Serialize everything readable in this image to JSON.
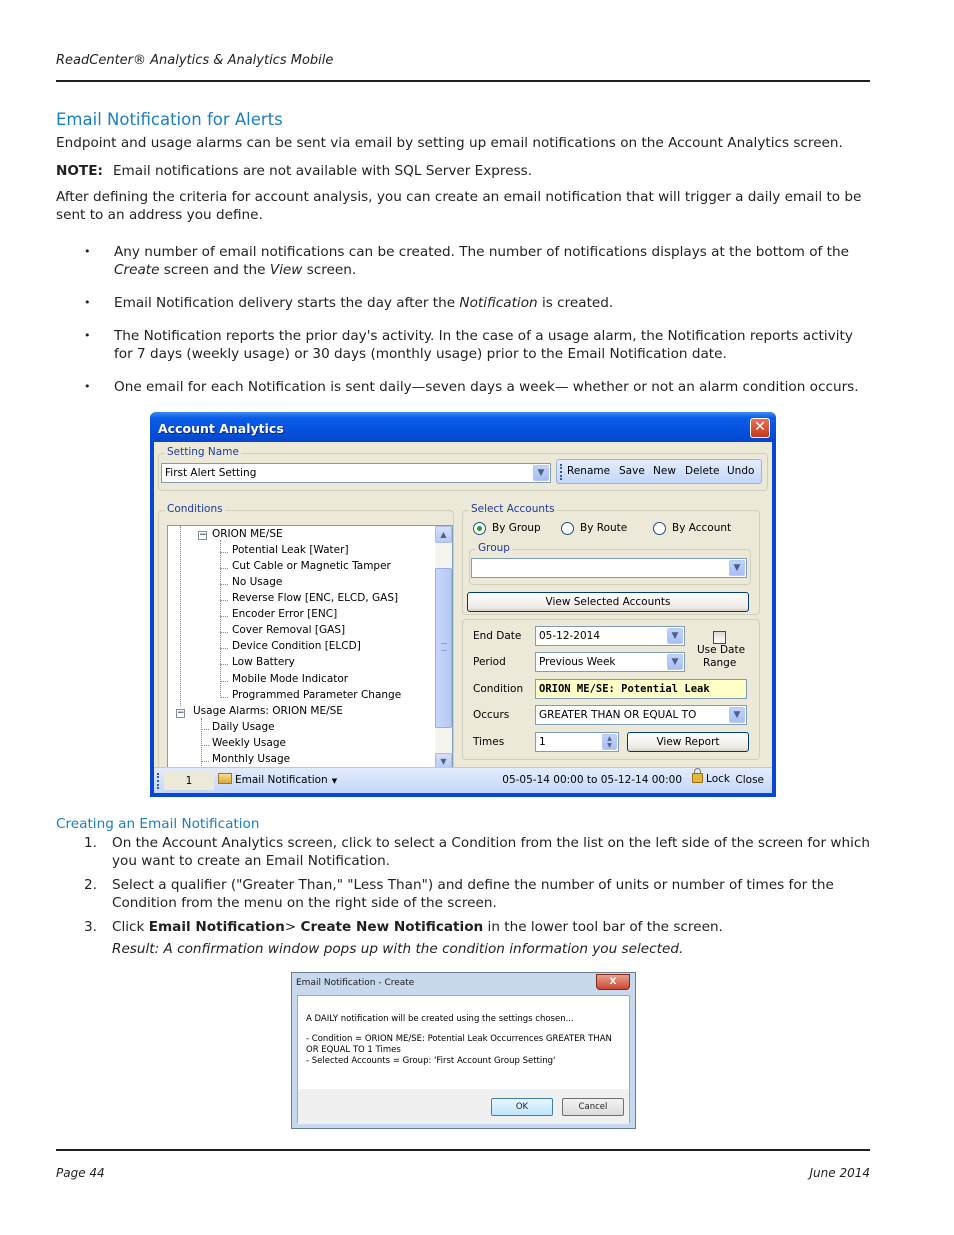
{
  "header": {
    "title": "ReadCenter® Analytics & Analytics Mobile"
  },
  "section": {
    "heading": "Email Notification for Alerts",
    "intro": "Endpoint and usage alarms can be sent via email by setting up email notifications on the Account Analytics screen.",
    "note_label": "NOTE:",
    "note_text": "Email notifications are not available with SQL Server Express.",
    "paragraph": "After defining the criteria for account analysis, you can create an email notification that will trigger a daily email to be sent to an address you define.",
    "bullets": [
      {
        "pre": "Any number of email notifications can be created. The number of notifications displays at the bottom of the ",
        "em1": "Create",
        "mid": " screen and the ",
        "em2": "View",
        "post": " screen."
      },
      {
        "pre": "Email Notification delivery starts the day after the ",
        "em1": "Notification",
        "post": " is created."
      },
      {
        "text": "The Notification reports the prior day's activity. In the case of a usage alarm, the Notification reports activity for 7 days (weekly usage) or 30 days (monthly usage) prior to the Email Notification date."
      },
      {
        "text": "One email for each Notification is sent daily—seven days a week— whether or not an alarm condition occurs."
      }
    ],
    "bullet_glyph": "•"
  },
  "window": {
    "title": "Account Analytics",
    "close_glyph": "✕",
    "setting_name": {
      "label": "Setting Name",
      "value": "First Alert Setting"
    },
    "toolbar": {
      "rename": "Rename",
      "save": "Save",
      "new": "New",
      "delete": "Delete",
      "undo": "Undo"
    },
    "conditions": {
      "label": "Conditions",
      "tree": {
        "group1": "ORION ME/SE",
        "group1_items": [
          "Potential Leak [Water]",
          "Cut Cable or Magnetic Tamper",
          "No Usage",
          "Reverse Flow [ENC, ELCD, GAS]",
          "Encoder Error [ENC]",
          "Cover Removal [GAS]",
          "Device Condition [ELCD]",
          "Low Battery",
          "Mobile Mode Indicator",
          "Programmed Parameter Change"
        ],
        "group2": "Usage Alarms: ORION ME/SE",
        "group2_items": [
          "Daily Usage",
          "Weekly Usage",
          "Monthly Usage"
        ],
        "expander_glyph": "−"
      }
    },
    "select_accounts": {
      "label": "Select Accounts",
      "options": [
        "By Group",
        "By Route",
        "By Account"
      ],
      "selected": "By Group",
      "group_label": "Group",
      "group_value": "",
      "view_button": "View Selected Accounts"
    },
    "criteria": {
      "end_date_label": "End Date",
      "end_date_value": "05-12-2014",
      "period_label": "Period",
      "period_value": "Previous Week",
      "use_date_range_label_1": "Use Date",
      "use_date_range_label_2": "Range",
      "use_date_range_checked": false,
      "condition_label": "Condition",
      "condition_value": "ORION ME/SE: Potential Leak",
      "occurs_label": "Occurs",
      "occurs_value": "GREATER THAN OR EQUAL TO",
      "times_label": "Times",
      "times_value": "1",
      "view_report_button": "View Report"
    },
    "statusbar": {
      "count": "1",
      "email_notification": "Email Notification",
      "range": "05-05-14 00:00 to 05-12-14 00:00",
      "lock": "Lock",
      "close": "Close"
    },
    "colors": {
      "title_bar": "#0552dc",
      "client_bg": "#ece9d8",
      "condition_bg": "#ffffc8"
    }
  },
  "creating": {
    "heading": "Creating an Email Notification",
    "steps": [
      {
        "num": "1.",
        "text": "On the Account Analytics screen, click to select a Condition from the list on the left side of the screen for which you want to create an Email Notification."
      },
      {
        "num": "2.",
        "text": "Select a qualifier (\"Greater Than,\" \"Less Than\") and define the number of units or number of times for the Condition from the menu on the right side of the screen."
      },
      {
        "num": "3.",
        "pre": "Click ",
        "bold1": "Email Notification",
        "mid": "> ",
        "bold2": "Create New Notification",
        "post": " in the lower tool bar of the screen."
      }
    ],
    "result": "Result: A confirmation window pops up with the condition information you selected."
  },
  "dialog": {
    "title": "Email Notification - Create",
    "close_glyph": "X",
    "line1": "A DAILY notification will be created using the settings chosen...",
    "line2": "- Condition = ORION ME/SE: Potential Leak Occurrences GREATER THAN OR EQUAL TO 1 Times",
    "line3": "- Selected Accounts = Group: 'First Account Group Setting'",
    "ok": "OK",
    "cancel": "Cancel"
  },
  "footer": {
    "page": "Page 44",
    "date": "June 2014"
  },
  "colors": {
    "heading": "#1a7fc1",
    "text": "#231f20"
  }
}
